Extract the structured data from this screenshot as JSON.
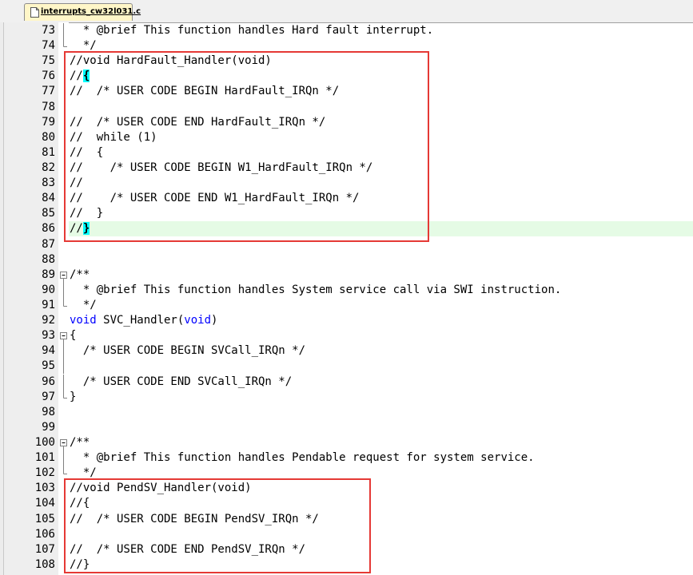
{
  "tab": {
    "label": "interrupts_cw32l031.c",
    "icon": "file-icon"
  },
  "colors": {
    "comment": "#008000",
    "keyword": "#0000ff",
    "highlight_box": "#e53935",
    "current_line": "#e5fbe5",
    "brace_match": "#00ffff"
  },
  "lines": [
    {
      "n": "73",
      "text": "  * @brief This function handles Hard fault interrupt.",
      "style": "comment",
      "fold": "line"
    },
    {
      "n": "74",
      "text": "  */",
      "style": "comment",
      "fold": "end"
    },
    {
      "n": "75",
      "text": "//void HardFault_Handler(void)",
      "style": "comment",
      "fold": ""
    },
    {
      "n": "76",
      "pre": "//",
      "brace": "{",
      "post": "",
      "style": "comment",
      "fold": ""
    },
    {
      "n": "77",
      "text": "//  /* USER CODE BEGIN HardFault_IRQn */",
      "style": "comment",
      "fold": ""
    },
    {
      "n": "78",
      "text": "",
      "style": "comment",
      "fold": ""
    },
    {
      "n": "79",
      "text": "//  /* USER CODE END HardFault_IRQn */",
      "style": "comment",
      "fold": ""
    },
    {
      "n": "80",
      "text": "//  while (1)",
      "style": "comment",
      "fold": ""
    },
    {
      "n": "81",
      "text": "//  {",
      "style": "comment",
      "fold": ""
    },
    {
      "n": "82",
      "text": "//    /* USER CODE BEGIN W1_HardFault_IRQn */",
      "style": "comment",
      "fold": ""
    },
    {
      "n": "83",
      "text": "//",
      "style": "comment",
      "fold": ""
    },
    {
      "n": "84",
      "text": "//    /* USER CODE END W1_HardFault_IRQn */",
      "style": "comment",
      "fold": ""
    },
    {
      "n": "85",
      "text": "//  }",
      "style": "comment",
      "fold": ""
    },
    {
      "n": "86",
      "pre": "//",
      "brace": "}",
      "post": "",
      "style": "comment",
      "fold": "",
      "current": true
    },
    {
      "n": "87",
      "text": "",
      "style": "plain",
      "fold": ""
    },
    {
      "n": "88",
      "text": "",
      "style": "plain",
      "fold": ""
    },
    {
      "n": "89",
      "text": "/**",
      "style": "comment",
      "fold": "start"
    },
    {
      "n": "90",
      "text": "  * @brief This function handles System service call via SWI instruction.",
      "style": "comment",
      "fold": "line"
    },
    {
      "n": "91",
      "text": "  */",
      "style": "comment",
      "fold": "end"
    },
    {
      "n": "92",
      "kw1": "void",
      "mid": " SVC_Handler(",
      "kw2": "void",
      "tail": ")",
      "style": "decl",
      "fold": ""
    },
    {
      "n": "93",
      "text": "{",
      "style": "plain",
      "fold": "start"
    },
    {
      "n": "94",
      "text": "  /* USER CODE BEGIN SVCall_IRQn */",
      "style": "comment",
      "fold": "line"
    },
    {
      "n": "95",
      "text": "",
      "style": "plain",
      "fold": "line"
    },
    {
      "n": "96",
      "text": "  /* USER CODE END SVCall_IRQn */",
      "style": "comment",
      "fold": "line"
    },
    {
      "n": "97",
      "text": "}",
      "style": "plain",
      "fold": "end"
    },
    {
      "n": "98",
      "text": "",
      "style": "plain",
      "fold": ""
    },
    {
      "n": "99",
      "text": "",
      "style": "plain",
      "fold": ""
    },
    {
      "n": "100",
      "text": "/**",
      "style": "comment",
      "fold": "start"
    },
    {
      "n": "101",
      "text": "  * @brief This function handles Pendable request for system service.",
      "style": "comment",
      "fold": "line"
    },
    {
      "n": "102",
      "text": "  */",
      "style": "comment",
      "fold": "end"
    },
    {
      "n": "103",
      "text": "//void PendSV_Handler(void)",
      "style": "comment",
      "fold": ""
    },
    {
      "n": "104",
      "text": "//{",
      "style": "comment",
      "fold": ""
    },
    {
      "n": "105",
      "text": "//  /* USER CODE BEGIN PendSV_IRQn */",
      "style": "comment",
      "fold": ""
    },
    {
      "n": "106",
      "text": "",
      "style": "comment",
      "fold": ""
    },
    {
      "n": "107",
      "text": "//  /* USER CODE END PendSV_IRQn */",
      "style": "comment",
      "fold": ""
    },
    {
      "n": "108",
      "text": "//}",
      "style": "comment",
      "fold": ""
    }
  ]
}
